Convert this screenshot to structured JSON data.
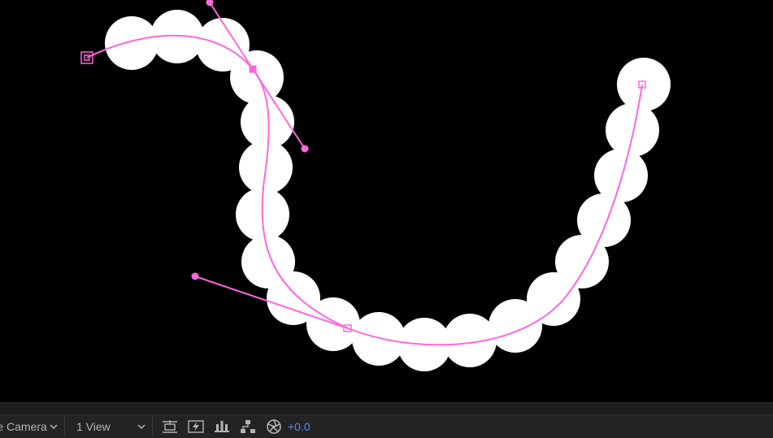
{
  "toolbar": {
    "camera_label": "Active Camera",
    "view_label": "1 View",
    "exposure_value": "+0.0"
  },
  "icons": {
    "camera_dropdown": "chevron-down-icon",
    "view_dropdown": "chevron-down-icon",
    "view_options": "view-layout-icon",
    "fast_previews": "fast-previews-icon",
    "timeline": "timeline-icon",
    "flowchart": "flowchart-icon",
    "exposure": "exposure-icon"
  },
  "colors": {
    "path": "#ff66dd",
    "circles": "#ffffff",
    "background": "#000000",
    "exposure_text": "#4a8cff"
  }
}
